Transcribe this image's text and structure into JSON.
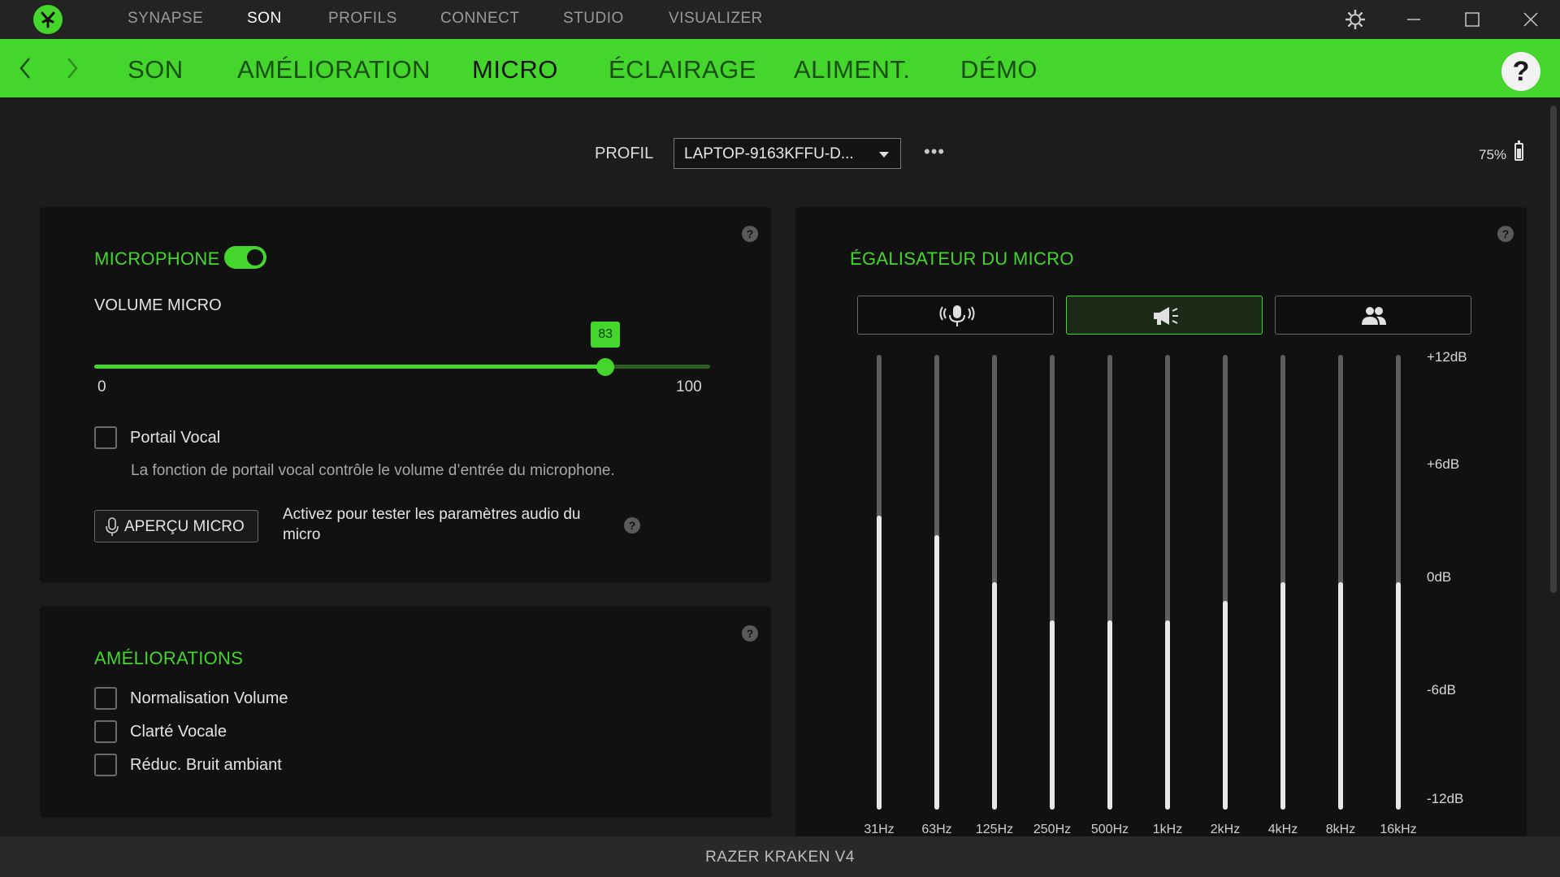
{
  "app": {
    "top_nav": [
      {
        "label": "SYNAPSE"
      },
      {
        "label": "SON"
      },
      {
        "label": "PROFILS"
      },
      {
        "label": "CONNECT"
      },
      {
        "label": "STUDIO"
      },
      {
        "label": "VISUALIZER"
      }
    ],
    "active_top_nav": "SON",
    "accent_color": "#44d62c"
  },
  "sub_nav": {
    "tabs": [
      {
        "label": "SON"
      },
      {
        "label": "AMÉLIORATION"
      },
      {
        "label": "MICRO"
      },
      {
        "label": "ÉCLAIRAGE"
      },
      {
        "label": "ALIMENT."
      },
      {
        "label": "DÉMO"
      }
    ],
    "active_tab": "MICRO",
    "help_label": "?"
  },
  "profile": {
    "label": "PROFIL",
    "selected": "LAPTOP-9163KFFU-D...",
    "more_label": "•••",
    "battery": "75%"
  },
  "microphone_panel": {
    "title": "MICROPHONE",
    "enabled": true,
    "volume_label": "VOLUME MICRO",
    "volume_value": "83",
    "volume_min": "0",
    "volume_max": "100",
    "voice_gate_label": "Portail Vocal",
    "voice_gate_checked": false,
    "voice_gate_description": "La fonction de portail vocal contrôle le volume d’entrée du microphone.",
    "preview_button_label": "APERÇU MICRO",
    "preview_description_line1": "Activez pour tester les paramètres audio du",
    "preview_description_line2": "micro"
  },
  "enhancements_panel": {
    "title": "AMÉLIORATIONS",
    "options": [
      {
        "label": "Normalisation Volume",
        "checked": false
      },
      {
        "label": "Clarté Vocale",
        "checked": false
      },
      {
        "label": "Réduc. Bruit ambiant",
        "checked": false
      }
    ]
  },
  "equalizer_panel": {
    "title": "ÉGALISATEUR DU MICRO",
    "presets": [
      {
        "icon": "microphone-voice-icon",
        "selected": false
      },
      {
        "icon": "megaphone-icon",
        "selected": true
      },
      {
        "icon": "people-icon",
        "selected": false
      }
    ],
    "db_labels": [
      "+12dB",
      "+6dB",
      "0dB",
      "-6dB",
      "-12dB"
    ],
    "bands": [
      {
        "freq": "31Hz",
        "gain_db": 3.5
      },
      {
        "freq": "63Hz",
        "gain_db": 2.5
      },
      {
        "freq": "125Hz",
        "gain_db": 0
      },
      {
        "freq": "250Hz",
        "gain_db": -2
      },
      {
        "freq": "500Hz",
        "gain_db": -2
      },
      {
        "freq": "1kHz",
        "gain_db": -2
      },
      {
        "freq": "2kHz",
        "gain_db": -1
      },
      {
        "freq": "4kHz",
        "gain_db": 0
      },
      {
        "freq": "8kHz",
        "gain_db": 0
      },
      {
        "freq": "16kHz",
        "gain_db": 0
      }
    ]
  },
  "footer": {
    "device_name": "RAZER KRAKEN V4"
  }
}
